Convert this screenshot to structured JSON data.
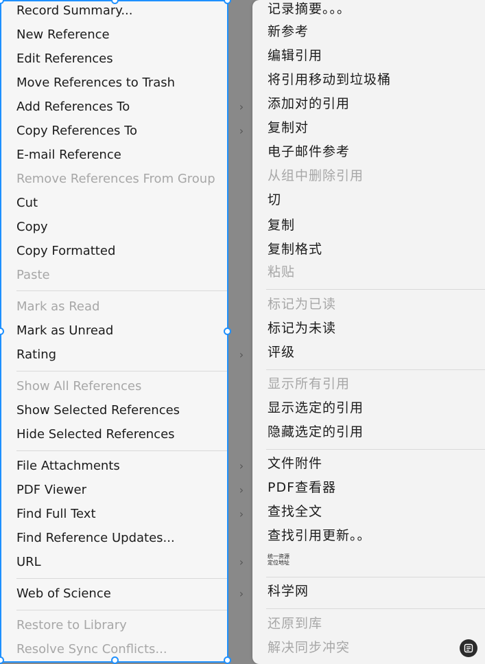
{
  "menu_en": {
    "items": [
      {
        "label": "Record Summary...",
        "disabled": false,
        "submenu": false
      },
      {
        "label": "New Reference",
        "disabled": false,
        "submenu": false
      },
      {
        "label": "Edit References",
        "disabled": false,
        "submenu": false
      },
      {
        "label": "Move References to Trash",
        "disabled": false,
        "submenu": false
      },
      {
        "label": "Add References To",
        "disabled": false,
        "submenu": true
      },
      {
        "label": "Copy References To",
        "disabled": false,
        "submenu": true
      },
      {
        "label": "E-mail Reference",
        "disabled": false,
        "submenu": false
      },
      {
        "label": "Remove References From Group",
        "disabled": true,
        "submenu": false
      },
      {
        "label": "Cut",
        "disabled": false,
        "submenu": false
      },
      {
        "label": "Copy",
        "disabled": false,
        "submenu": false
      },
      {
        "label": "Copy Formatted",
        "disabled": false,
        "submenu": false
      },
      {
        "label": "Paste",
        "disabled": true,
        "submenu": false
      },
      {
        "label": "Mark as Read",
        "disabled": true,
        "submenu": false
      },
      {
        "label": "Mark as Unread",
        "disabled": false,
        "submenu": false
      },
      {
        "label": "Rating",
        "disabled": false,
        "submenu": true
      },
      {
        "label": "Show All References",
        "disabled": true,
        "submenu": false
      },
      {
        "label": "Show Selected References",
        "disabled": false,
        "submenu": false
      },
      {
        "label": "Hide Selected References",
        "disabled": false,
        "submenu": false
      },
      {
        "label": "File Attachments",
        "disabled": false,
        "submenu": true
      },
      {
        "label": "PDF Viewer",
        "disabled": false,
        "submenu": true
      },
      {
        "label": "Find Full Text",
        "disabled": false,
        "submenu": true
      },
      {
        "label": "Find Reference Updates...",
        "disabled": false,
        "submenu": false
      },
      {
        "label": "URL",
        "disabled": false,
        "submenu": true
      },
      {
        "label": "Web of Science",
        "disabled": false,
        "submenu": true
      },
      {
        "label": "Restore to Library",
        "disabled": true,
        "submenu": false
      },
      {
        "label": "Resolve Sync Conflicts...",
        "disabled": true,
        "submenu": false
      }
    ]
  },
  "menu_zh": {
    "items": [
      {
        "label": "记录摘要。。。",
        "disabled": false
      },
      {
        "label": "新参考",
        "disabled": false
      },
      {
        "label": "编辑引用",
        "disabled": false
      },
      {
        "label": "将引用移动到垃圾桶",
        "disabled": false
      },
      {
        "label": "添加对的引用",
        "disabled": false
      },
      {
        "label": "复制对",
        "disabled": false
      },
      {
        "label": "电子邮件参考",
        "disabled": false
      },
      {
        "label": "从组中删除引用",
        "disabled": true
      },
      {
        "label": "切",
        "disabled": false
      },
      {
        "label": "复制",
        "disabled": false
      },
      {
        "label": "复制格式",
        "disabled": false
      },
      {
        "label": "粘贴",
        "disabled": true
      },
      {
        "label": "标记为已读",
        "disabled": true
      },
      {
        "label": "标记为未读",
        "disabled": false
      },
      {
        "label": "评级",
        "disabled": false
      },
      {
        "label": "显示所有引用",
        "disabled": true
      },
      {
        "label": "显示选定的引用",
        "disabled": false
      },
      {
        "label": "隐藏选定的引用",
        "disabled": false
      },
      {
        "label": "文件附件",
        "disabled": false
      },
      {
        "label": "PDF查看器",
        "disabled": false
      },
      {
        "label": "查找全文",
        "disabled": false
      },
      {
        "label": "查找引用更新。。",
        "disabled": false
      },
      {
        "label": "统一资源定位地址",
        "disabled": false,
        "small": true
      },
      {
        "label": "科学网",
        "disabled": false
      },
      {
        "label": "还原到库",
        "disabled": true
      },
      {
        "label": "解决同步冲突",
        "disabled": true
      }
    ]
  },
  "icons": {
    "chevron": "chevron-right-icon",
    "note": "note-icon"
  },
  "colors": {
    "selection": "#1e90ff",
    "disabled": "#a7a7a7",
    "text": "#1b1b1b"
  }
}
